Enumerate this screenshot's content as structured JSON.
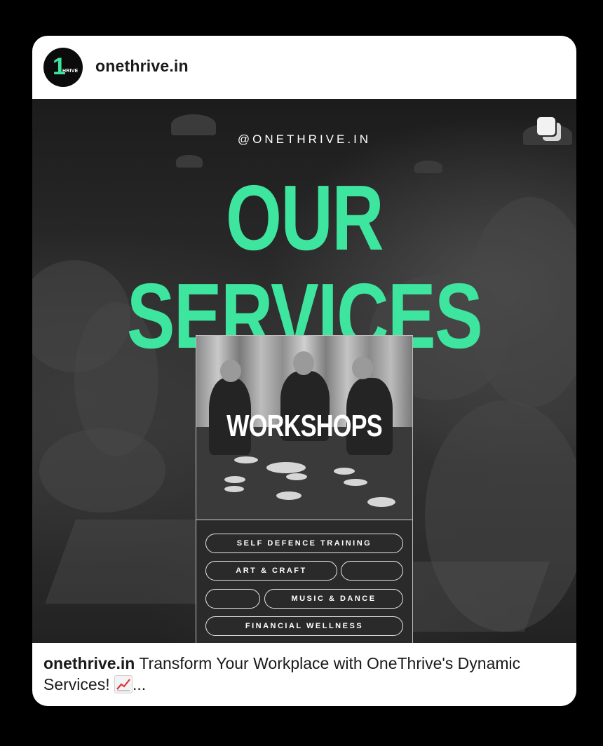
{
  "post": {
    "username": "onethrive.in",
    "avatar_text_big": "1",
    "avatar_text_small": "HRIVE",
    "image": {
      "handle": "@ONETHRIVE.IN",
      "headline": "OUR SERVICES",
      "panel_title": "WORKSHOPS",
      "pills": [
        "SELF DEFENCE TRAINING",
        "ART & CRAFT",
        "",
        "",
        "MUSIC & DANCE",
        "FINANCIAL WELLNESS"
      ]
    },
    "caption": {
      "username": "onethrive.in",
      "text": " Transform Your Workplace with OneThrive's Dynamic Services! ",
      "more": "..."
    }
  },
  "colors": {
    "accent": "#3ee59e",
    "background": "#000000",
    "card": "#ffffff"
  },
  "icons": {
    "multi_image": "carousel-icon",
    "emoji": "chart-increasing-emoji"
  }
}
